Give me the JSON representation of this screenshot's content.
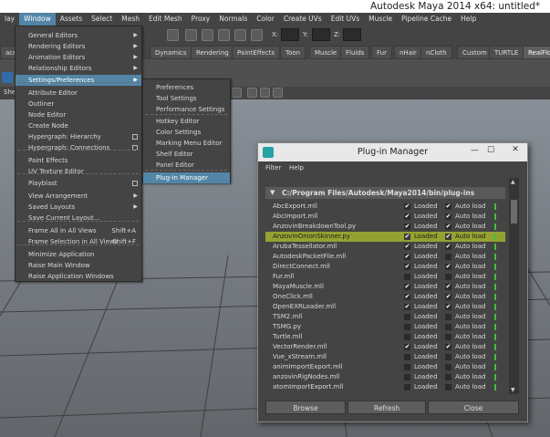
{
  "app_title": "Autodesk Maya 2014 x64: untitled*",
  "menubar": [
    "lay",
    "Window",
    "Assets",
    "Select",
    "Mesh",
    "Edit Mesh",
    "Proxy",
    "Normals",
    "Color",
    "Create UVs",
    "Edit UVs",
    "Muscle",
    "Pipeline Cache",
    "Help"
  ],
  "status_line": {
    "x_label": "X:",
    "y_label": "Y:",
    "z_label": "Z:"
  },
  "shelf_tabs": [
    "aces",
    "Dynamics",
    "Rendering",
    "PaintEffects",
    "Toon",
    "Muscle",
    "Fluids",
    "Fur",
    "nHair",
    "nCloth",
    "Custom",
    "TURTLE",
    "RealFlo"
  ],
  "shelf_fragment": "She",
  "window_menu": {
    "items": [
      {
        "label": "General Editors",
        "arrow": true
      },
      {
        "label": "Rendering Editors",
        "arrow": true
      },
      {
        "label": "Animation Editors",
        "arrow": true
      },
      {
        "label": "Relationship Editors",
        "arrow": true
      },
      {
        "label": "Settings/Preferences",
        "arrow": true,
        "highlighted": true
      },
      {
        "label": "Attribute Editor"
      },
      {
        "label": "Outliner"
      },
      {
        "label": "Node Editor"
      },
      {
        "label": "Create Node"
      },
      {
        "label": "Hypergraph: Hierarchy",
        "box": true
      },
      {
        "label": "Hypergraph: Connections",
        "box": true
      },
      {
        "label": "Paint Effects"
      },
      {
        "label": "UV Texture Editor"
      },
      {
        "label": "Playblast",
        "box": true
      },
      {
        "label": "View Arrangement",
        "arrow": true
      },
      {
        "label": "Saved Layouts",
        "arrow": true
      },
      {
        "label": "Save Current Layout..."
      },
      {
        "label": "Frame All in All Views",
        "shortcut": "Shift+A"
      },
      {
        "label": "Frame Selection in All Views",
        "shortcut": "Shift+F"
      },
      {
        "label": "Minimize Application"
      },
      {
        "label": "Raise Main Window"
      },
      {
        "label": "Raise Application Windows"
      }
    ]
  },
  "settings_submenu": {
    "items": [
      "Preferences",
      "Tool Settings",
      "Performance Settings",
      "Hotkey Editor",
      "Color Settings",
      "Marking Menu Editor",
      "Shelf Editor",
      "Panel Editor",
      "Plug-in Manager"
    ]
  },
  "plugin_manager": {
    "title": "Plug-in Manager",
    "menus": [
      "Filter",
      "Help"
    ],
    "path": "C:/Program Files/Autodesk/Maya2014/bin/plug-ins",
    "loaded_label": "Loaded",
    "auto_load_label": "Auto load",
    "plugins": [
      {
        "name": "AbcExport.mll",
        "loaded": true,
        "auto": true
      },
      {
        "name": "AbcImport.mll",
        "loaded": true,
        "auto": true
      },
      {
        "name": "AnzovinBreakdownTool.py",
        "loaded": true,
        "auto": true
      },
      {
        "name": "AnzovinOnionSkinner.py",
        "loaded": true,
        "auto": true,
        "selected": true
      },
      {
        "name": "ArubaTessellator.mll",
        "loaded": true,
        "auto": true
      },
      {
        "name": "AutodeskPacketFile.mll",
        "loaded": true,
        "auto": false
      },
      {
        "name": "DirectConnect.mll",
        "loaded": true,
        "auto": true
      },
      {
        "name": "Fur.mll",
        "loaded": false,
        "auto": false
      },
      {
        "name": "MayaMuscle.mll",
        "loaded": true,
        "auto": true
      },
      {
        "name": "OneClick.mll",
        "loaded": true,
        "auto": true
      },
      {
        "name": "OpenEXRLoader.mll",
        "loaded": true,
        "auto": true
      },
      {
        "name": "TSM2.mll",
        "loaded": false,
        "auto": false
      },
      {
        "name": "TSMG.py",
        "loaded": false,
        "auto": false
      },
      {
        "name": "Turtle.mll",
        "loaded": false,
        "auto": false
      },
      {
        "name": "VectorRender.mll",
        "loaded": true,
        "auto": true
      },
      {
        "name": "Vue_xStream.mll",
        "loaded": false,
        "auto": false
      },
      {
        "name": "animImportExport.mll",
        "loaded": false,
        "auto": false
      },
      {
        "name": "anzovinRigNodes.mll",
        "loaded": false,
        "auto": false
      },
      {
        "name": "atomImportExport.mll",
        "loaded": false,
        "auto": false
      }
    ],
    "buttons": {
      "browse": "Browse",
      "refresh": "Refresh",
      "close": "Close"
    }
  }
}
